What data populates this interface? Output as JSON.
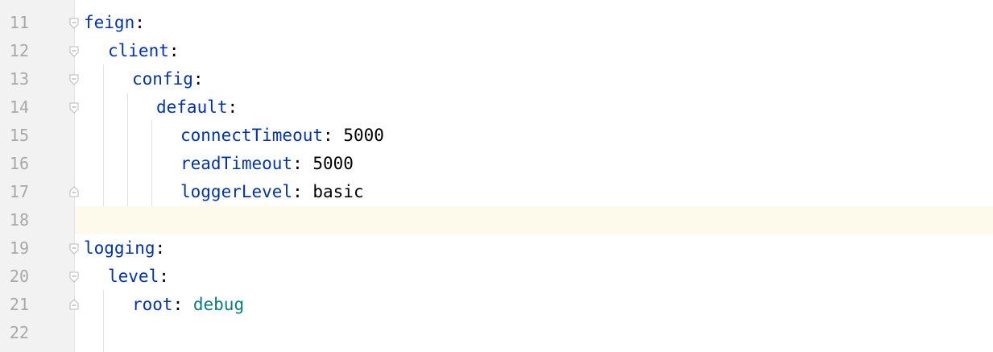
{
  "editor": {
    "lines": [
      {
        "num": "11",
        "key": "feign",
        "colon": ":",
        "value": ""
      },
      {
        "num": "12",
        "key": "client",
        "colon": ":",
        "value": ""
      },
      {
        "num": "13",
        "key": "config",
        "colon": ":",
        "value": ""
      },
      {
        "num": "14",
        "key": "default",
        "colon": ":",
        "value": ""
      },
      {
        "num": "15",
        "key": "connectTimeout",
        "colon": ": ",
        "value": "5000"
      },
      {
        "num": "16",
        "key": "readTimeout",
        "colon": ": ",
        "value": "5000"
      },
      {
        "num": "17",
        "key": "loggerLevel",
        "colon": ": ",
        "value": "basic"
      },
      {
        "num": "18",
        "key": "",
        "colon": "",
        "value": ""
      },
      {
        "num": "19",
        "key": "logging",
        "colon": ":",
        "value": ""
      },
      {
        "num": "20",
        "key": "level",
        "colon": ":",
        "value": ""
      },
      {
        "num": "21",
        "key": "root",
        "colon": ": ",
        "value": "debug"
      },
      {
        "num": "22",
        "key": "",
        "colon": "",
        "value": ""
      }
    ],
    "current_line": "18",
    "colors": {
      "key": "#0033b3",
      "enum_value": "#067d78",
      "current_line_bg": "#fdfaeb",
      "gutter_bg": "#f2f2f2"
    }
  }
}
